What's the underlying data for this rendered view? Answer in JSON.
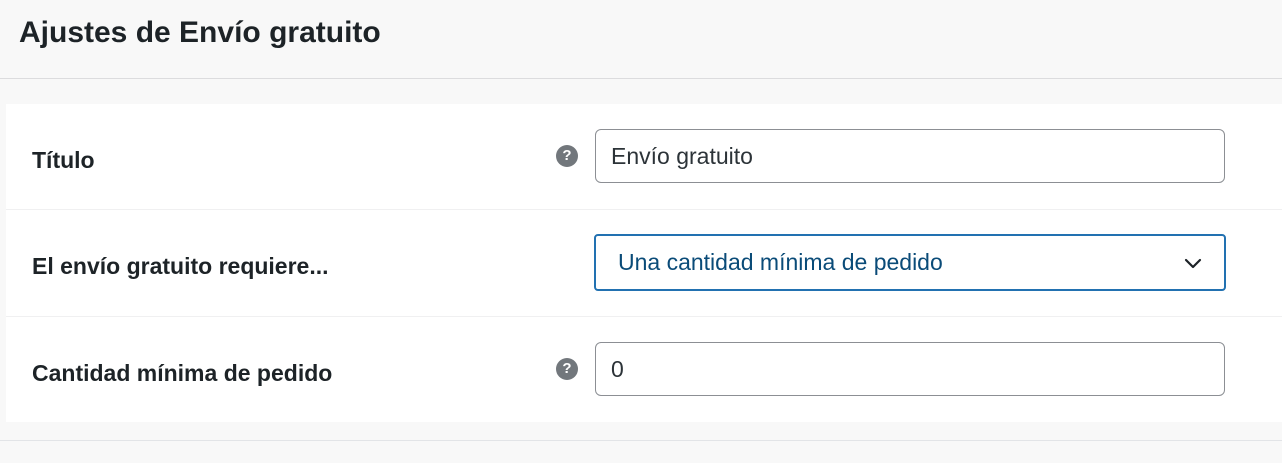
{
  "header": {
    "title": "Ajustes de Envío gratuito"
  },
  "settings": {
    "rows": [
      {
        "label": "Título",
        "help_icon": "question-circle-icon",
        "value": "Envío gratuito"
      },
      {
        "label": "El envío gratuito requiere...",
        "selected_option": "Una cantidad mínima de pedido",
        "dropdown_icon": "chevron-down-icon"
      },
      {
        "label": "Cantidad mínima de pedido",
        "help_icon": "question-circle-icon",
        "value": "0"
      }
    ]
  },
  "colors": {
    "accent": "#2271b1",
    "select_text": "#0a4b78",
    "help_icon_bg": "#72777c"
  }
}
